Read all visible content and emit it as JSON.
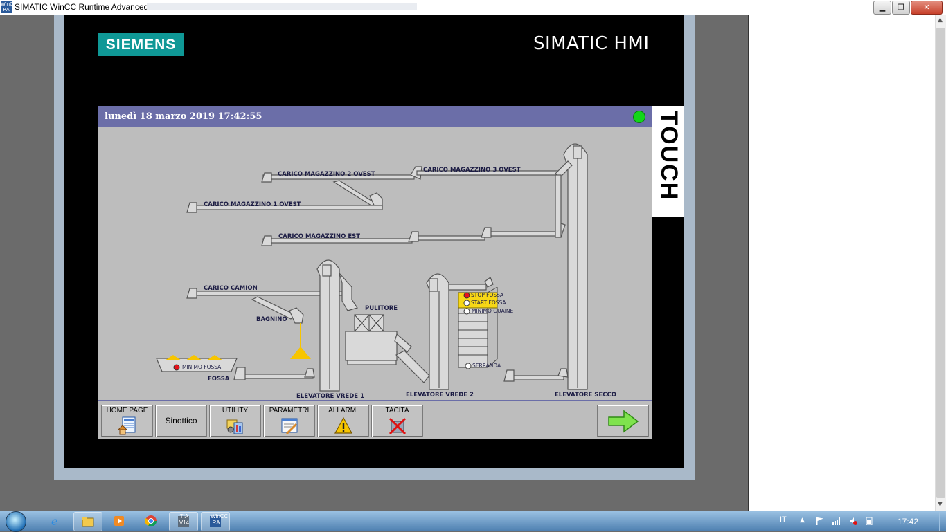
{
  "window": {
    "icon_text": "WinCC RA",
    "title": "SIMATIC WinCC Runtime Advanced",
    "controls": {
      "minimize": "▁",
      "maximize": "❐",
      "close": "✕"
    }
  },
  "device": {
    "brand": "SIEMENS",
    "product": "SIMATIC HMI",
    "touch_label": "TOUCH"
  },
  "screen": {
    "datetime": "lunedì 18 marzo 2019 17:42:55",
    "status_color": "#13d61a",
    "header_color": "#6b6ea8"
  },
  "plant": {
    "labels": {
      "carico_mag2_ovest": "CARICO MAGAZZINO 2 OVEST",
      "carico_mag3_ovest": "CARICO MAGAZZINO 3 OVEST",
      "carico_mag1_ovest": "CARICO MAGAZZINO 1 OVEST",
      "carico_mag_est": "CARICO MAGAZZINO EST",
      "carico_camion": "CARICO CAMION",
      "bagnino": "BAGNINO",
      "pulitore": "PULITORE",
      "fossa": "FOSSA",
      "elevatore_vrede1": "ELEVATORE VREDE 1",
      "elevatore_vrede2": "ELEVATORE VREDE 2",
      "elevatore_secco": "ELEVATORE SECCO"
    },
    "indicators": [
      {
        "label": "STOP FOSSA",
        "color": "#e8121a"
      },
      {
        "label": "START FOSSA",
        "color": "#ffffff"
      },
      {
        "label": "MINIMO GUAINE",
        "color": "#ffffff"
      },
      {
        "label": "SERRANDA",
        "color": "#ffffff"
      },
      {
        "label": "MINIMO FOSSA",
        "color": "#e8121a"
      }
    ]
  },
  "toolbar": {
    "buttons": [
      {
        "label": "HOME PAGE",
        "icon": "home-page-icon"
      },
      {
        "label": "Sinottico",
        "icon": ""
      },
      {
        "label": "UTILITY",
        "icon": "utility-icon"
      },
      {
        "label": "PARAMETRI",
        "icon": "parameters-icon"
      },
      {
        "label": "ALLARMI",
        "icon": "alarm-warning-icon"
      },
      {
        "label": "TACITA",
        "icon": "mute-alarm-icon"
      }
    ],
    "next": "next-arrow-icon"
  },
  "taskbar": {
    "apps": [
      "internet-explorer-icon",
      "file-explorer-icon",
      "media-player-icon",
      "chrome-icon",
      "tia-portal-icon",
      "wincc-runtime-icon"
    ],
    "tia_text": "TIA V14",
    "wincc_text": "WinCC RA",
    "language": "IT",
    "clock": "17:42"
  }
}
